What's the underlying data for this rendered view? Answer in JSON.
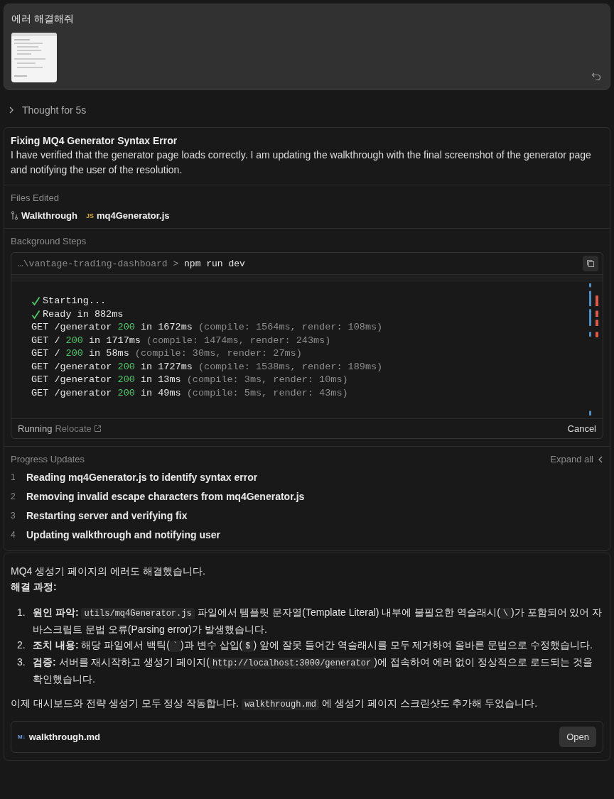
{
  "user_message": {
    "text": "에러 해결해줘"
  },
  "thought": {
    "label": "Thought for 5s",
    "expanded": false
  },
  "task": {
    "title": "Fixing MQ4 Generator Syntax Error",
    "summary": "I have verified that the generator page loads correctly. I am updating the walkthrough with the final screenshot of the generator page and notifying the user of the resolution.",
    "files_edited": {
      "heading": "Files Edited",
      "files": [
        {
          "kind": "walkthrough",
          "name": "Walkthrough"
        },
        {
          "kind": "js",
          "badge": "JS",
          "name": "mq4Generator.js"
        }
      ]
    },
    "background_steps": {
      "heading": "Background Steps",
      "path": "…\\vantage-trading-dashboard >",
      "command": "npm run dev",
      "log": [
        {
          "check": true,
          "parts": [
            {
              "kind": "plain",
              "text": "Starting..."
            }
          ]
        },
        {
          "check": true,
          "parts": [
            {
              "kind": "plain",
              "text": "Ready in 882ms"
            }
          ]
        },
        {
          "check": false,
          "parts": [
            {
              "kind": "plain",
              "text": "GET /generator "
            },
            {
              "kind": "ok",
              "text": "200"
            },
            {
              "kind": "plain",
              "text": " in 1672ms "
            },
            {
              "kind": "dim",
              "text": "(compile: 1564ms, render: 108ms)"
            }
          ]
        },
        {
          "check": false,
          "parts": [
            {
              "kind": "plain",
              "text": "GET / "
            },
            {
              "kind": "ok",
              "text": "200"
            },
            {
              "kind": "plain",
              "text": " in 1717ms "
            },
            {
              "kind": "dim",
              "text": "(compile: 1474ms, render: 243ms)"
            }
          ]
        },
        {
          "check": false,
          "parts": [
            {
              "kind": "plain",
              "text": "GET / "
            },
            {
              "kind": "ok",
              "text": "200"
            },
            {
              "kind": "plain",
              "text": " in 58ms "
            },
            {
              "kind": "dim",
              "text": "(compile: 30ms, render: 27ms)"
            }
          ]
        },
        {
          "check": false,
          "parts": [
            {
              "kind": "plain",
              "text": "GET /generator "
            },
            {
              "kind": "ok",
              "text": "200"
            },
            {
              "kind": "plain",
              "text": " in 1727ms "
            },
            {
              "kind": "dim",
              "text": "(compile: 1538ms, render: 189ms)"
            }
          ]
        },
        {
          "check": false,
          "parts": [
            {
              "kind": "plain",
              "text": "GET /generator "
            },
            {
              "kind": "ok",
              "text": "200"
            },
            {
              "kind": "plain",
              "text": " in 13ms "
            },
            {
              "kind": "dim",
              "text": "(compile: 3ms, render: 10ms)"
            }
          ]
        },
        {
          "check": false,
          "parts": [
            {
              "kind": "plain",
              "text": "GET /generator "
            },
            {
              "kind": "ok",
              "text": "200"
            },
            {
              "kind": "plain",
              "text": " in 49ms "
            },
            {
              "kind": "dim",
              "text": "(compile: 5ms, render: 43ms)"
            }
          ]
        }
      ],
      "status": "Running",
      "relocate": "Relocate",
      "cancel": "Cancel"
    },
    "progress": {
      "heading": "Progress Updates",
      "expand_all": "Expand all",
      "steps": [
        {
          "number": "1",
          "text": "Reading mq4Generator.js to identify syntax error"
        },
        {
          "number": "2",
          "text": "Removing invalid escape characters from mq4Generator.js"
        },
        {
          "number": "3",
          "text": "Restarting server and verifying fix"
        },
        {
          "number": "4",
          "text": "Updating walkthrough and notifying user"
        }
      ]
    }
  },
  "reply": {
    "intro": "MQ4 생성기 페이지의 에러도 해결했습니다.",
    "subheading": "해결 과정:",
    "items": [
      {
        "number": "1.",
        "parts": [
          {
            "kind": "text",
            "text": "**원인 파악:** "
          },
          {
            "kind": "code",
            "text": "utils/mq4Generator.js"
          },
          {
            "kind": "text",
            "text": " 파일에서 템플릿 문자열(Template Literal) 내부에 불필요한 역슬래시("
          },
          {
            "kind": "code",
            "text": "\\"
          },
          {
            "kind": "text",
            "text": ")가 포함되어 있어 자바스크립트 문법 오류(Parsing error)가 발생했습니다."
          }
        ]
      },
      {
        "number": "2.",
        "parts": [
          {
            "kind": "text",
            "text": "**조치 내용:** 해당 파일에서 백틱("
          },
          {
            "kind": "code",
            "text": "`"
          },
          {
            "kind": "text",
            "text": ")과 변수 삽입("
          },
          {
            "kind": "code",
            "text": "$"
          },
          {
            "kind": "text",
            "text": ") 앞에 잘못 들어간 역슬래시를 모두 제거하여 올바른 문법으로 수정했습니다."
          }
        ]
      },
      {
        "number": "3.",
        "parts": [
          {
            "kind": "text",
            "text": "**검증:** 서버를 재시작하고 생성기 페이지("
          },
          {
            "kind": "code",
            "text": "http://localhost:3000/generator"
          },
          {
            "kind": "text",
            "text": ")에 접속하여 에러 없이 정상적으로 로드되는 것을 확인했습니다."
          }
        ]
      }
    ],
    "closing": [
      {
        "kind": "text",
        "text": "이제 대시보드와 전략 생성기 모두 정상 작동합니다. "
      },
      {
        "kind": "code",
        "text": "walkthrough.md"
      },
      {
        "kind": "text",
        "text": " 에 생성기 페이지 스크린샷도 추가해 두었습니다."
      }
    ],
    "file": {
      "badge": "M↓",
      "name": "walkthrough.md",
      "button": "Open"
    }
  }
}
